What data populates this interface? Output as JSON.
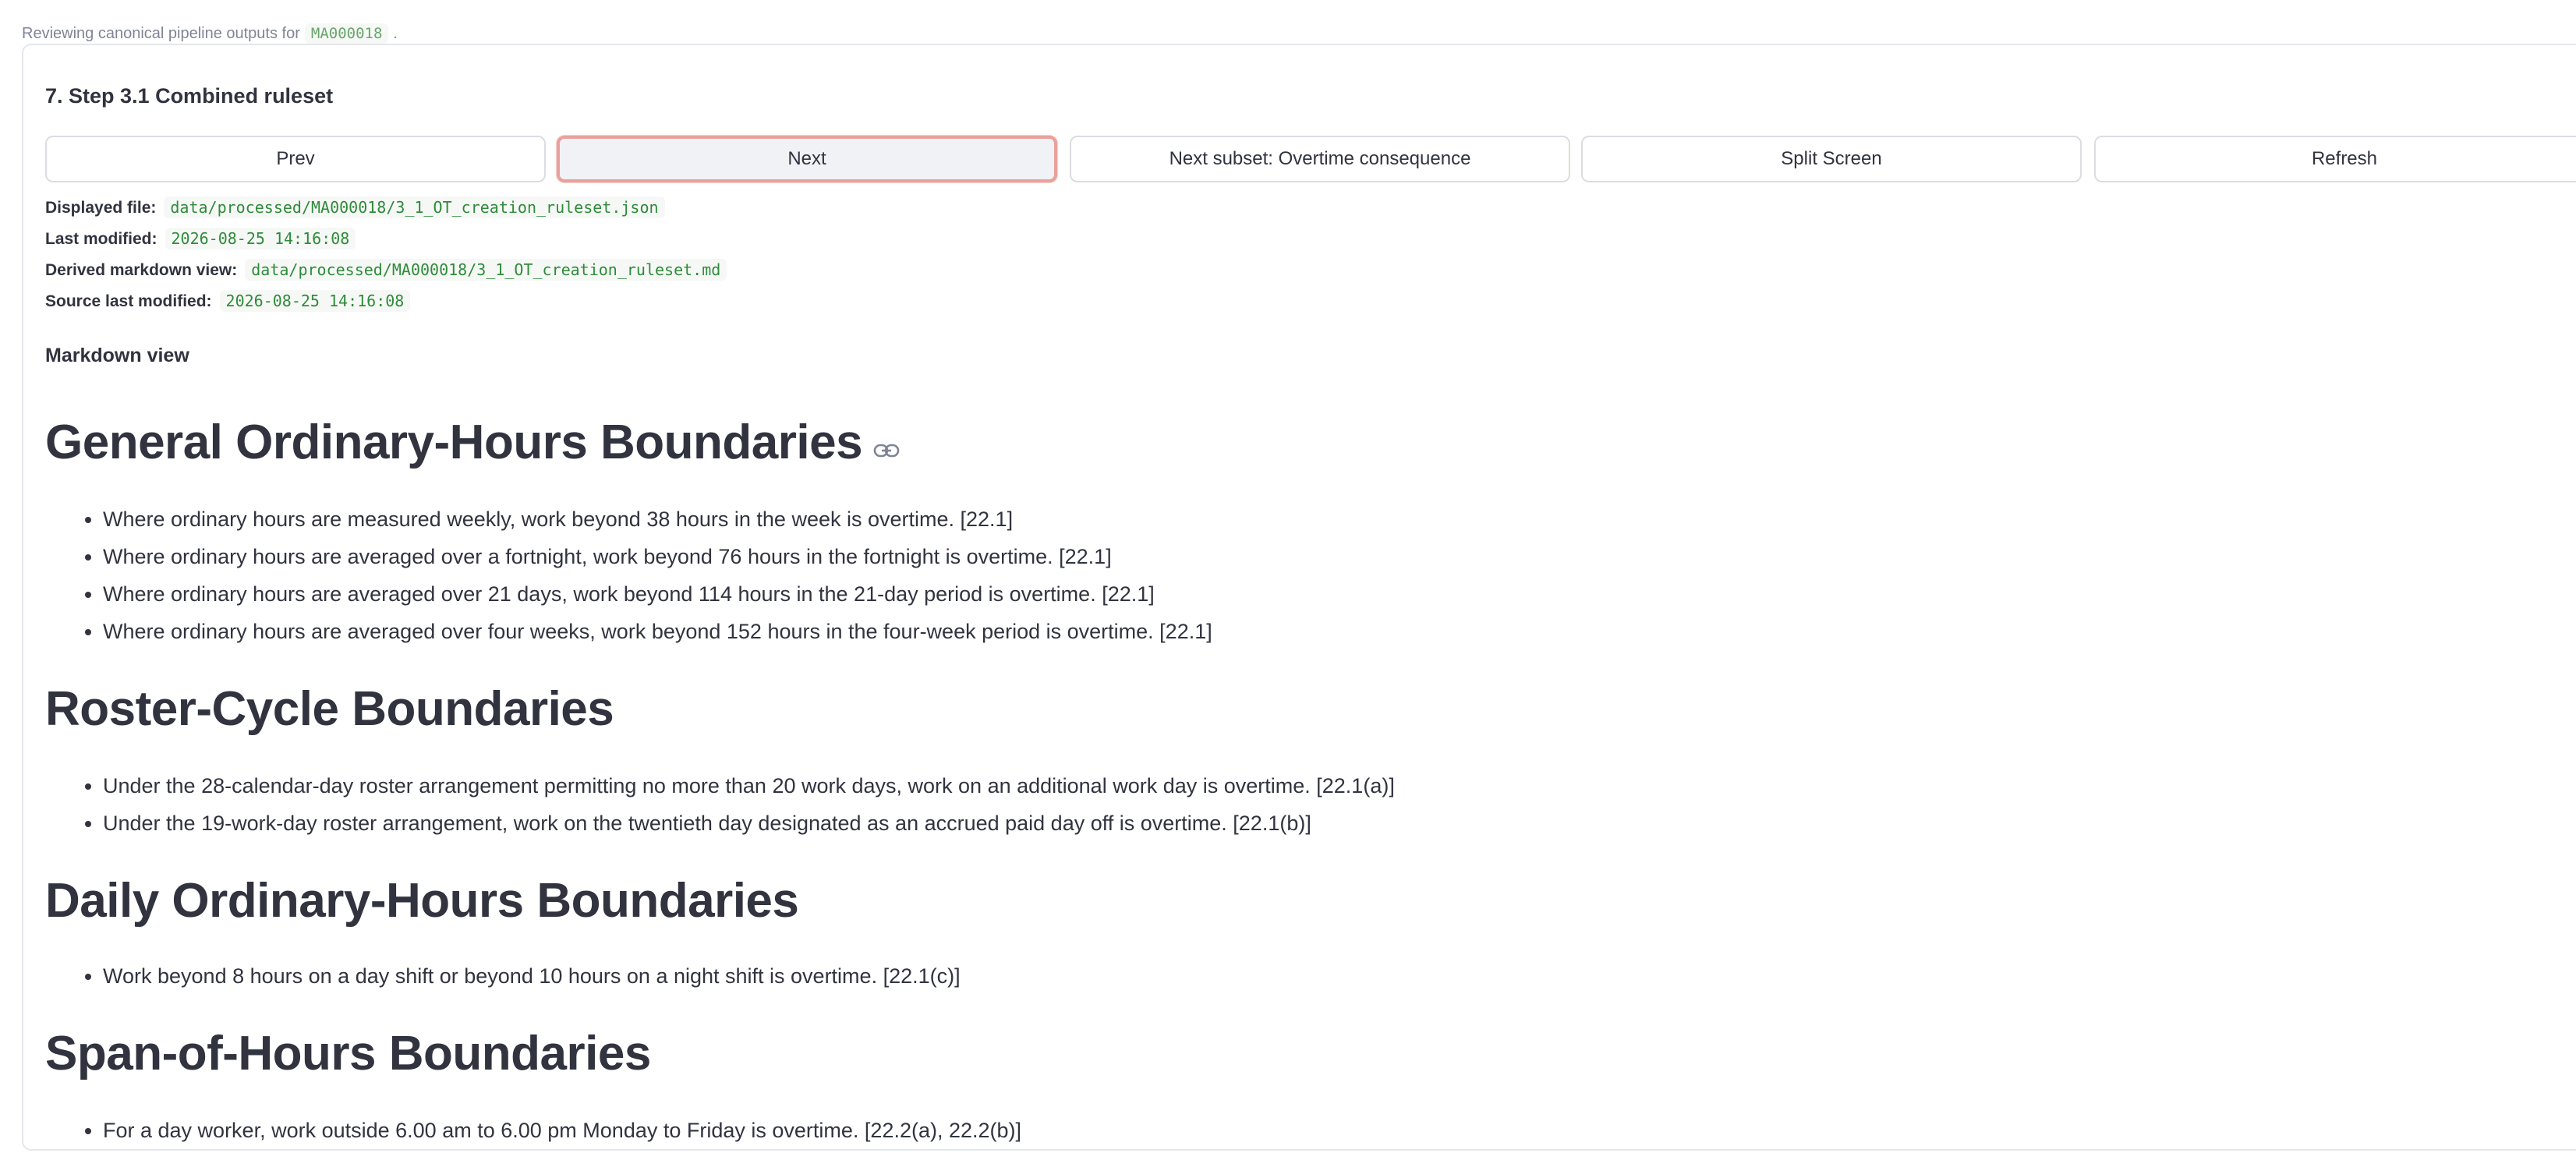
{
  "intro": {
    "text": "Reviewing canonical pipeline outputs for",
    "id": "MA000018",
    "suffix": "."
  },
  "step": {
    "title": "7. Step 3.1 Combined ruleset"
  },
  "buttons": {
    "prev": "Prev",
    "next": "Next",
    "next_subset": "Next subset: Overtime consequence",
    "split_screen": "Split Screen",
    "refresh": "Refresh"
  },
  "meta": {
    "displayed_file_label": "Displayed file:",
    "displayed_file_value": "data/processed/MA000018/3_1_OT_creation_ruleset.json",
    "last_modified_label": "Last modified:",
    "last_modified_value": "2026-08-25 14:16:08",
    "derived_label": "Derived markdown view:",
    "derived_value": "data/processed/MA000018/3_1_OT_creation_ruleset.md",
    "source_modified_label": "Source last modified:",
    "source_modified_value": "2026-08-25 14:16:08"
  },
  "markdown": {
    "label": "Markdown view",
    "sections": [
      {
        "heading": "General Ordinary-Hours Boundaries",
        "items": [
          "Where ordinary hours are measured weekly, work beyond 38 hours in the week is overtime. [22.1]",
          "Where ordinary hours are averaged over a fortnight, work beyond 76 hours in the fortnight is overtime. [22.1]",
          "Where ordinary hours are averaged over 21 days, work beyond 114 hours in the 21-day period is overtime. [22.1]",
          "Where ordinary hours are averaged over four weeks, work beyond 152 hours in the four-week period is overtime. [22.1]"
        ]
      },
      {
        "heading": "Roster-Cycle Boundaries",
        "items": [
          "Under the 28-calendar-day roster arrangement permitting no more than 20 work days, work on an additional work day is overtime. [22.1(a)]",
          "Under the 19-work-day roster arrangement, work on the twentieth day designated as an accrued paid day off is overtime. [22.1(b)]"
        ]
      },
      {
        "heading": "Daily Ordinary-Hours Boundaries",
        "items": [
          "Work beyond 8 hours on a day shift or beyond 10 hours on a night shift is overtime. [22.1(c)]"
        ]
      },
      {
        "heading": "Span-of-Hours Boundaries",
        "items": [
          "For a day worker, work outside 6.00 am to 6.00 pm Monday to Friday is overtime. [22.2(a), 22.2(b)]"
        ]
      }
    ]
  }
}
